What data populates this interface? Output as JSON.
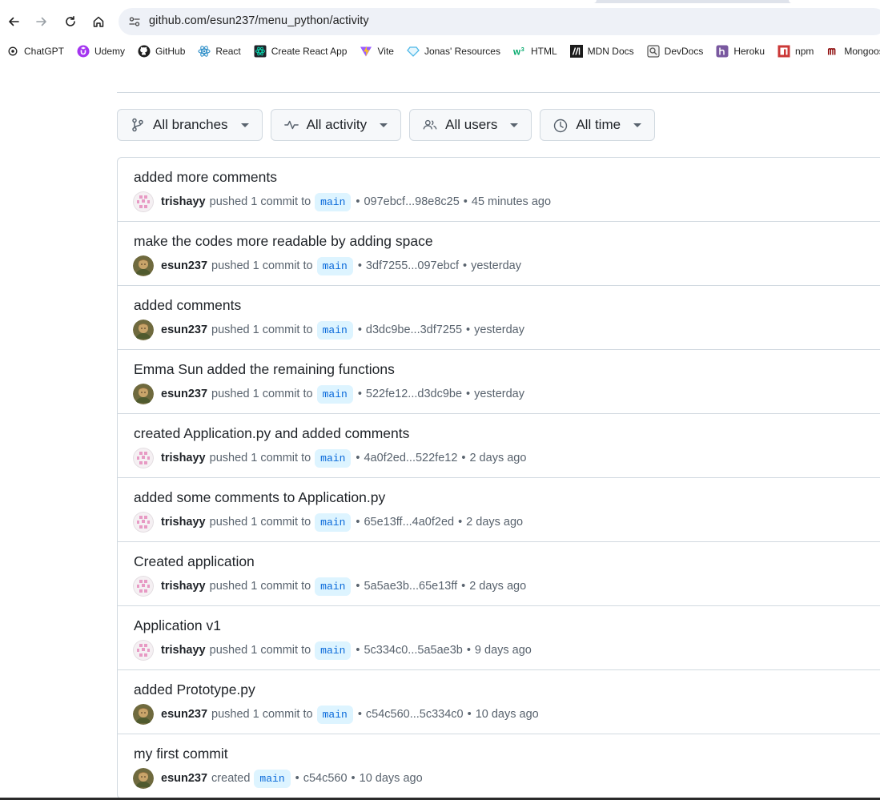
{
  "browser": {
    "url": "github.com/esun237/menu_python/activity",
    "bookmarks": [
      {
        "label": "ChatGPT",
        "icon": "chatgpt-icon",
        "color": "#1f1f1f"
      },
      {
        "label": "Udemy",
        "icon": "udemy-icon",
        "color": "#a435f0"
      },
      {
        "label": "GitHub",
        "icon": "github-icon",
        "color": "#1f1f1f"
      },
      {
        "label": "React",
        "icon": "react-icon",
        "color": "#2f8fc8"
      },
      {
        "label": "Create React App",
        "icon": "create-react-app-icon",
        "color": "#09d3ac"
      },
      {
        "label": "Vite",
        "icon": "vite-icon",
        "color": "#9a5cff"
      },
      {
        "label": "Jonas' Resources",
        "icon": "diamond-icon",
        "color": "#4db8e8"
      },
      {
        "label": "HTML",
        "icon": "w3-icon",
        "color": "#04aa6d"
      },
      {
        "label": "MDN Docs",
        "icon": "mdn-icon",
        "color": "#1b1b1b"
      },
      {
        "label": "DevDocs",
        "icon": "devdocs-icon",
        "color": "#555555"
      },
      {
        "label": "Heroku",
        "icon": "heroku-icon",
        "color": "#79589f"
      },
      {
        "label": "npm",
        "icon": "npm-icon",
        "color": "#cb3837"
      },
      {
        "label": "Mongoose",
        "icon": "mongoose-icon",
        "color": "#880000"
      }
    ]
  },
  "filters": [
    {
      "label": "All branches",
      "icon": "git-branch-icon"
    },
    {
      "label": "All activity",
      "icon": "pulse-icon"
    },
    {
      "label": "All users",
      "icon": "people-icon"
    },
    {
      "label": "All time",
      "icon": "clock-icon"
    }
  ],
  "activity": [
    {
      "title": "added more comments",
      "user": "trishayy",
      "avatar": "pink-identicon",
      "action": "pushed 1 commit to",
      "branch": "main",
      "range": "097ebcf...98e8c25",
      "time": "45 minutes ago"
    },
    {
      "title": "make the codes more readable by adding space",
      "user": "esun237",
      "avatar": "photo",
      "action": "pushed 1 commit to",
      "branch": "main",
      "range": "3df7255...097ebcf",
      "time": "yesterday"
    },
    {
      "title": "added comments",
      "user": "esun237",
      "avatar": "photo",
      "action": "pushed 1 commit to",
      "branch": "main",
      "range": "d3dc9be...3df7255",
      "time": "yesterday"
    },
    {
      "title": "Emma Sun added the remaining functions",
      "user": "esun237",
      "avatar": "photo",
      "action": "pushed 1 commit to",
      "branch": "main",
      "range": "522fe12...d3dc9be",
      "time": "yesterday"
    },
    {
      "title": "created Application.py and added comments",
      "user": "trishayy",
      "avatar": "pink-identicon",
      "action": "pushed 1 commit to",
      "branch": "main",
      "range": "4a0f2ed...522fe12",
      "time": "2 days ago"
    },
    {
      "title": "added some comments to Application.py",
      "user": "trishayy",
      "avatar": "pink-identicon",
      "action": "pushed 1 commit to",
      "branch": "main",
      "range": "65e13ff...4a0f2ed",
      "time": "2 days ago"
    },
    {
      "title": "Created application",
      "user": "trishayy",
      "avatar": "pink-identicon",
      "action": "pushed 1 commit to",
      "branch": "main",
      "range": "5a5ae3b...65e13ff",
      "time": "2 days ago"
    },
    {
      "title": "Application v1",
      "user": "trishayy",
      "avatar": "pink-identicon",
      "action": "pushed 1 commit to",
      "branch": "main",
      "range": "5c334c0...5a5ae3b",
      "time": "9 days ago"
    },
    {
      "title": "added Prototype.py",
      "user": "esun237",
      "avatar": "photo",
      "action": "pushed 1 commit to",
      "branch": "main",
      "range": "c54c560...5c334c0",
      "time": "10 days ago"
    },
    {
      "title": "my first commit",
      "user": "esun237",
      "avatar": "photo",
      "action": "created",
      "branch": "main",
      "range": "c54c560",
      "time": "10 days ago"
    }
  ]
}
